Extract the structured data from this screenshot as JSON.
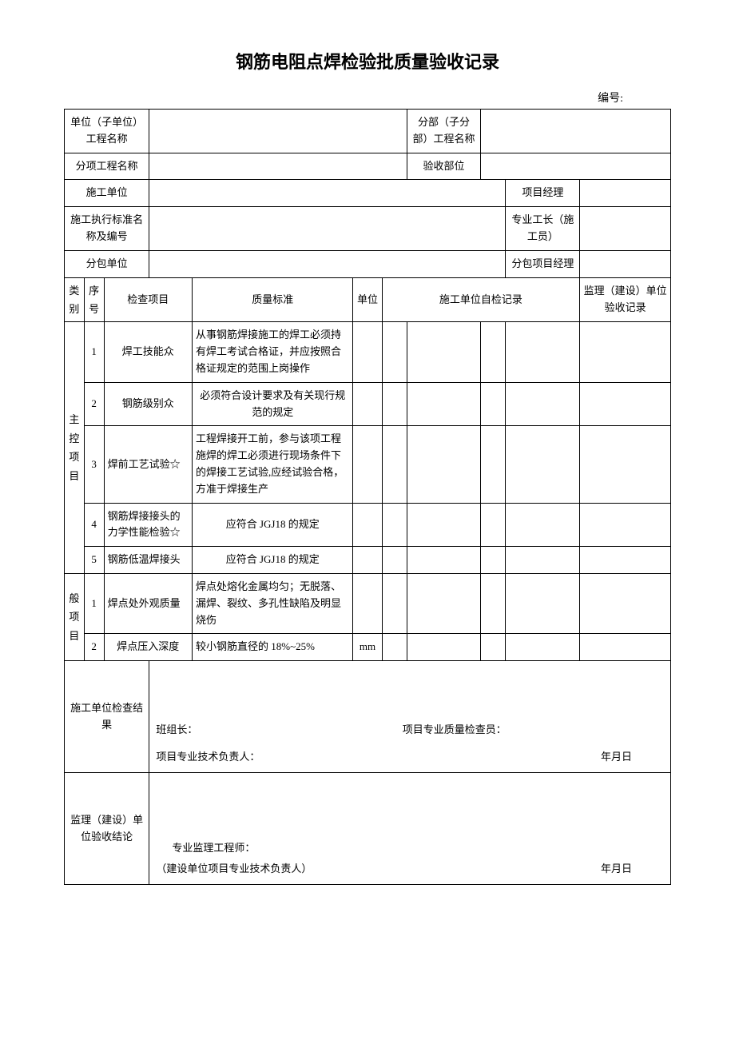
{
  "title": "钢筋电阻点焊检验批质量验收记录",
  "serial_label": "编号:",
  "headers": {
    "unit_project": "单位（子单位）工程名称",
    "sub_project": "分部（子分部）工程名称",
    "item_project": "分项工程名称",
    "accept_part": "验收部位",
    "construct_unit": "施工单位",
    "project_manager": "项目经理",
    "standard_name": "施工执行标准名称及编号",
    "pro_foreman": "专业工长（施工员）",
    "subcontract_unit": "分包单位",
    "subcontract_manager": "分包项目经理",
    "category": "类别",
    "seq": "序号",
    "check_item": "检查项目",
    "quality_std": "质量标准",
    "unit": "单位",
    "self_check": "施工单位自检记录",
    "supervisor_record": "监理（建设）单位验收记录"
  },
  "categories": {
    "main": "主控项目",
    "general": "般项目"
  },
  "main_items": [
    {
      "seq": "1",
      "name": "焊工技能众",
      "std": "从事钢筋焊接施工的焊工必须持有焊工考试合格证，并应按照合格证规定的范围上岗操作",
      "unit": ""
    },
    {
      "seq": "2",
      "name": "钢筋级别众",
      "std": "必须符合设计要求及有关现行规范的规定",
      "unit": ""
    },
    {
      "seq": "3",
      "name": "焊前工艺试验☆",
      "std": "工程焊接开工前，参与该项工程施焊的焊工必须进行现场条件下的焊接工艺试验,应经试验合格，方准于焊接生产",
      "unit": ""
    },
    {
      "seq": "4",
      "name": "钢筋焊接接头的力学性能检验☆",
      "std": "应符合 JGJ18 的规定",
      "unit": ""
    },
    {
      "seq": "5",
      "name": "钢筋低温焊接头",
      "std": "应符合 JGJ18 的规定",
      "unit": ""
    }
  ],
  "general_items": [
    {
      "seq": "1",
      "name": "焊点处外观质量",
      "std": "焊点处熔化金属均匀；无脱落、漏焊、裂纹、多孔性缺陷及明显烧伤",
      "unit": ""
    },
    {
      "seq": "2",
      "name": "焊点压入深度",
      "std": "较小钢筋直径的 18%~25%",
      "unit": "mm"
    }
  ],
  "footer": {
    "construct_result": "施工单位检查结果",
    "team_leader": "班组长：",
    "quality_inspector": "项目专业质量检查员：",
    "tech_leader": "项目专业技术负责人：",
    "date": "年月日",
    "supervisor_conclusion": "监理（建设）单位验收结论",
    "supervisor_engineer": "专业监理工程师：",
    "owner_tech_leader": "（建设单位项目专业技术负责人）"
  }
}
